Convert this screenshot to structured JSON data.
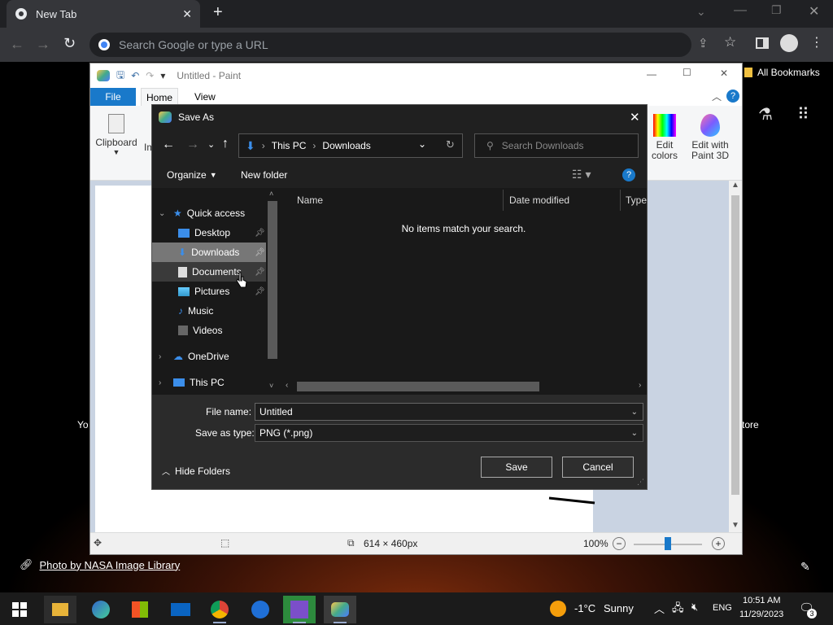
{
  "browser": {
    "tab_title": "New Tab",
    "address_placeholder": "Search Google or type a URL",
    "bookmarks_label": "All Bookmarks",
    "photo_credit": "Photo by NASA Image Library",
    "shortcut_left_label": "Yo",
    "shortcut_right_label": "tore"
  },
  "paint": {
    "title": "Untitled - Paint",
    "tabs": [
      "File",
      "Home",
      "View"
    ],
    "clipboard_label": "Clipboard",
    "image_label_partial": "Im",
    "edit_colors_label": "Edit\ncolors",
    "paint3d_label": "Edit with\nPaint 3D",
    "canvas_size": "614 × 460px",
    "zoom": "100%"
  },
  "dialog": {
    "title": "Save As",
    "path": [
      "This PC",
      "Downloads"
    ],
    "search_placeholder": "Search Downloads",
    "organize_label": "Organize",
    "new_folder_label": "New folder",
    "nav_items": [
      {
        "label": "Quick access",
        "icon": "star-icon"
      },
      {
        "label": "Desktop",
        "icon": "desktop-icon"
      },
      {
        "label": "Downloads",
        "icon": "download-icon"
      },
      {
        "label": "Documents",
        "icon": "document-icon"
      },
      {
        "label": "Pictures",
        "icon": "picture-icon"
      },
      {
        "label": "Music",
        "icon": "music-icon"
      },
      {
        "label": "Videos",
        "icon": "video-icon"
      },
      {
        "label": "OneDrive",
        "icon": "cloud-icon"
      },
      {
        "label": "This PC",
        "icon": "computer-icon"
      }
    ],
    "columns": [
      "Name",
      "Date modified",
      "Type"
    ],
    "empty_message": "No items match your search.",
    "file_name_label": "File name:",
    "file_name_value": "Untitled",
    "save_type_label": "Save as type:",
    "save_type_value": "PNG (*.png)",
    "hide_folders_label": "Hide Folders",
    "save_label": "Save",
    "cancel_label": "Cancel"
  },
  "taskbar": {
    "weather_temp": "-1°C",
    "weather_text": "Sunny",
    "lang": "ENG",
    "time": "10:51 AM",
    "date": "11/29/2023",
    "notification_count": "3"
  }
}
